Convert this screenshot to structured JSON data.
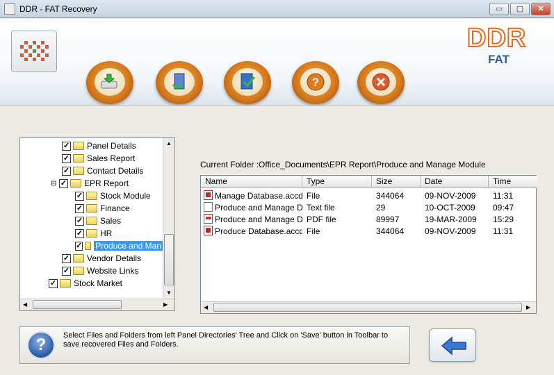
{
  "window": {
    "title": "DDR - FAT Recovery",
    "minimize_label": "▭",
    "maximize_label": "▢",
    "close_label": "✕"
  },
  "brand": {
    "name": "DDR",
    "subtitle": "FAT"
  },
  "toolbar": {
    "buttons": [
      {
        "name": "save",
        "icon": "save-drive-icon"
      },
      {
        "name": "open",
        "icon": "door-exit-icon"
      },
      {
        "name": "about",
        "icon": "book-check-icon"
      },
      {
        "name": "help",
        "icon": "question-icon"
      },
      {
        "name": "exit",
        "icon": "close-x-icon"
      }
    ]
  },
  "tree": {
    "items": [
      {
        "label": "Panel Details",
        "checked": true,
        "expanded": false
      },
      {
        "label": "Sales Report",
        "checked": true,
        "expanded": false
      },
      {
        "label": "Contact Details",
        "checked": true,
        "expanded": false
      },
      {
        "label": "EPR Report",
        "checked": true,
        "expanded": true
      },
      {
        "label": "Stock Module",
        "checked": true,
        "expanded": false
      },
      {
        "label": "Finance",
        "checked": true,
        "expanded": false
      },
      {
        "label": "Sales",
        "checked": true,
        "expanded": false
      },
      {
        "label": "HR",
        "checked": true,
        "expanded": false
      },
      {
        "label": "Produce and Man",
        "checked": true,
        "expanded": false,
        "selected": true
      },
      {
        "label": "Vendor Details",
        "checked": true,
        "expanded": false
      },
      {
        "label": "Website Links",
        "checked": true,
        "expanded": false
      },
      {
        "label": "Stock Market",
        "checked": true,
        "expanded": false
      }
    ]
  },
  "current_folder": {
    "label": "Current Folder  :",
    "path": "Office_Documents\\EPR Report\\Produce and Manage Module"
  },
  "file_list": {
    "columns": [
      "Name",
      "Type",
      "Size",
      "Date",
      "Time"
    ],
    "rows": [
      {
        "name": "Manage Database.accdb",
        "type": "File",
        "size": "344064",
        "date": "09-NOV-2009",
        "time": "11:31",
        "icon": "access-db-icon"
      },
      {
        "name": "Produce and Manage D...",
        "type": "Text file",
        "size": "29",
        "date": "10-OCT-2009",
        "time": "09:47",
        "icon": "text-file-icon"
      },
      {
        "name": "Produce and Manage D...",
        "type": "PDF file",
        "size": "89997",
        "date": "19-MAR-2009",
        "time": "15:29",
        "icon": "pdf-file-icon"
      },
      {
        "name": "Produce Database.accdb",
        "type": "File",
        "size": "344064",
        "date": "09-NOV-2009",
        "time": "11:31",
        "icon": "access-db-icon"
      }
    ]
  },
  "info": {
    "text": "Select Files and Folders from left Panel Directories' Tree and Click on 'Save' button in Toolbar to save recovered Files and Folders."
  },
  "colors": {
    "accent_orange": "#e86a1a",
    "brand_blue": "#2e5f8f",
    "selection": "#3399ff"
  }
}
